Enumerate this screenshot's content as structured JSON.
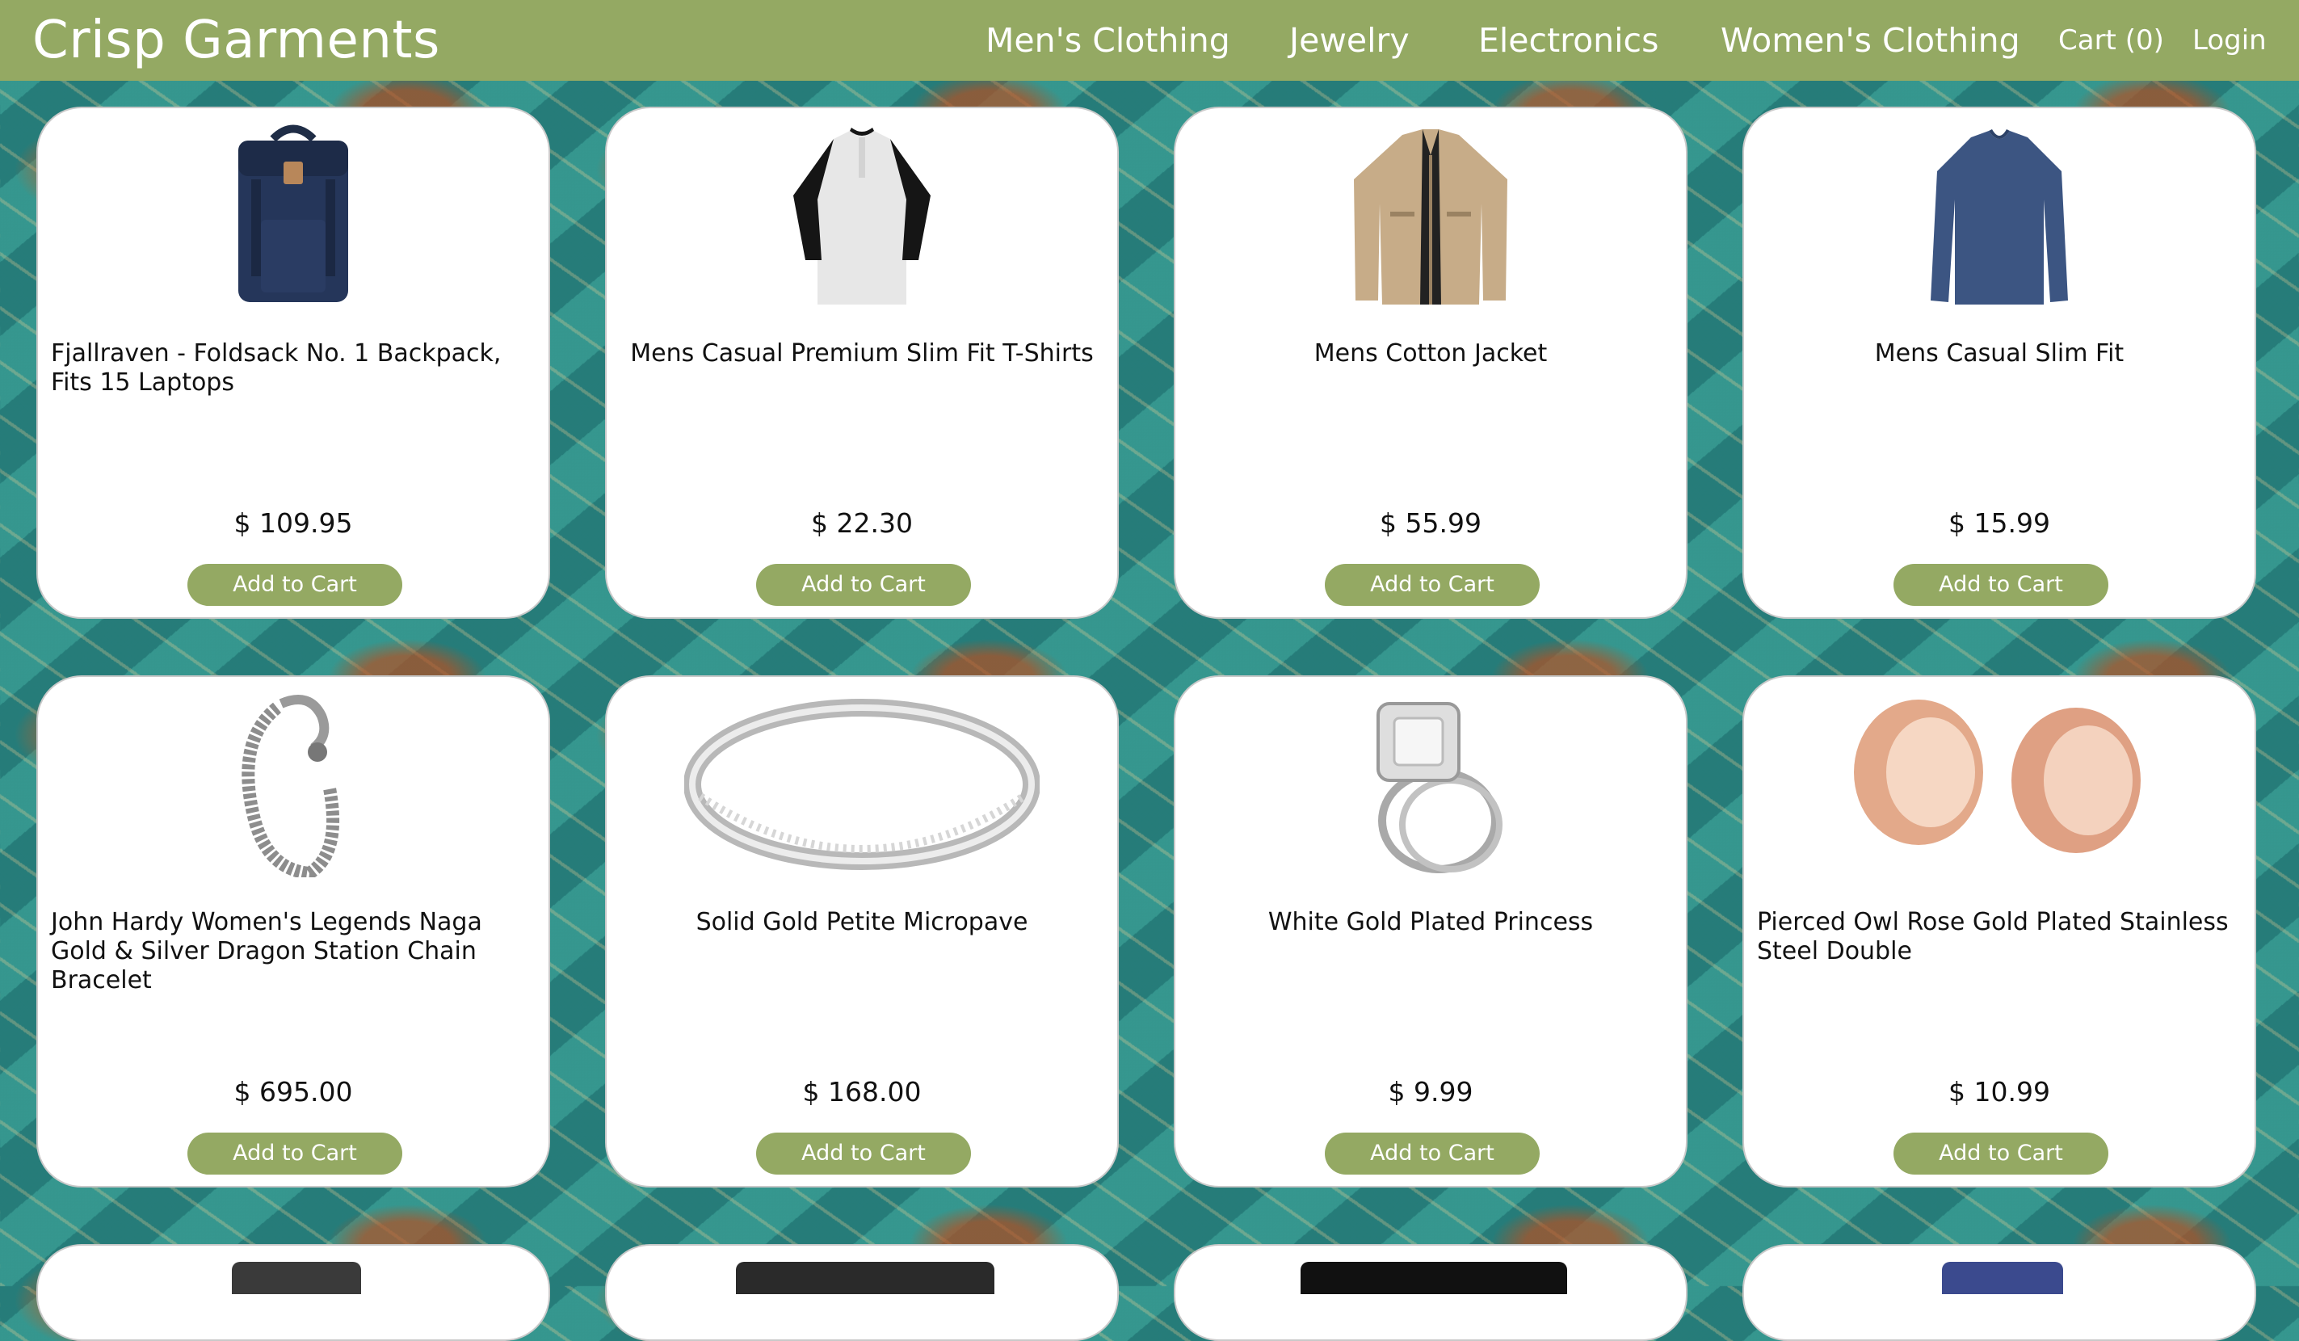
{
  "brand": "Crisp Garments",
  "nav": {
    "mens": "Men's Clothing",
    "jewelry": "Jewelry",
    "electronics": "Electronics",
    "womens": "Women's Clothing",
    "cart": "Cart (0)",
    "login": "Login"
  },
  "products": [
    {
      "title": "Fjallraven - Foldsack No. 1 Backpack, Fits 15 Laptops",
      "price": "$ 109.95",
      "button": "Add to Cart",
      "image": "backpack-image"
    },
    {
      "title": "Mens Casual Premium Slim Fit T-Shirts",
      "price": "$ 22.30",
      "button": "Add to Cart",
      "image": "tshirt-image"
    },
    {
      "title": "Mens Cotton Jacket",
      "price": "$ 55.99",
      "button": "Add to Cart",
      "image": "jacket-image"
    },
    {
      "title": "Mens Casual Slim Fit",
      "price": "$ 15.99",
      "button": "Add to Cart",
      "image": "longsleeve-image"
    },
    {
      "title": "John Hardy Women's Legends Naga Gold & Silver Dragon Station Chain Bracelet",
      "price": "$ 695.00",
      "button": "Add to Cart",
      "image": "bracelet-image"
    },
    {
      "title": "Solid Gold Petite Micropave",
      "price": "$ 168.00",
      "button": "Add to Cart",
      "image": "ring-band-image"
    },
    {
      "title": "White Gold Plated Princess",
      "price": "$ 9.99",
      "button": "Add to Cart",
      "image": "princess-ring-image"
    },
    {
      "title": "Pierced Owl Rose Gold Plated Stainless Steel Double",
      "price": "$ 10.99",
      "button": "Add to Cart",
      "image": "plugs-image"
    }
  ],
  "colors": {
    "accent": "#94a963",
    "background": "#2f8d87"
  }
}
